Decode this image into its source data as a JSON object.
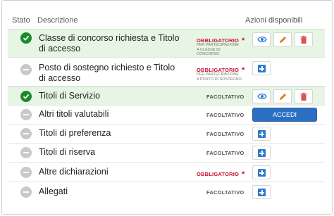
{
  "header": {
    "stato": "Stato",
    "descrizione": "Descrizione",
    "azioni": "Azioni disponibili"
  },
  "rows": [
    {
      "label": "Classe di concorso richiesta e Titolo di accesso",
      "status": "done",
      "tag": "OBBLIGATORIO",
      "note": "PER PARTECIPAZIONE A CLASSE DI CONCORSO"
    },
    {
      "label": "Posto di sostegno richiesto e Titolo di accesso",
      "status": "todo",
      "tag": "OBBLIGATORIO",
      "note": "PER PARTECIPAZIONE A POSTO DI SOSTEGNO"
    },
    {
      "label": "Titoli di Servizio",
      "status": "done",
      "tag": "FACOLTATIVO"
    },
    {
      "label": "Altri titoli valutabili",
      "status": "todo",
      "tag": "FACOLTATIVO",
      "action": "ACCEDI"
    },
    {
      "label": "Titoli di preferenza",
      "status": "todo",
      "tag": "FACOLTATIVO"
    },
    {
      "label": "Titoli di riserva",
      "status": "todo",
      "tag": "FACOLTATIVO"
    },
    {
      "label": "Altre dichiarazioni",
      "status": "todo",
      "tag": "OBBLIGATORIO"
    },
    {
      "label": "Allegati",
      "status": "todo",
      "tag": "FACOLTATIVO"
    }
  ],
  "required_marker": "*",
  "icons": [
    "check-icon",
    "minus-icon",
    "eye-icon",
    "pencil-icon",
    "trash-icon",
    "plus-icon"
  ],
  "colors": {
    "success": "#1b8a2c",
    "row_done_bg": "#e6f5e4",
    "required": "#c8102e",
    "primary": "#2b6fc0",
    "edit": "#e07a1f",
    "delete": "#d9534f"
  }
}
